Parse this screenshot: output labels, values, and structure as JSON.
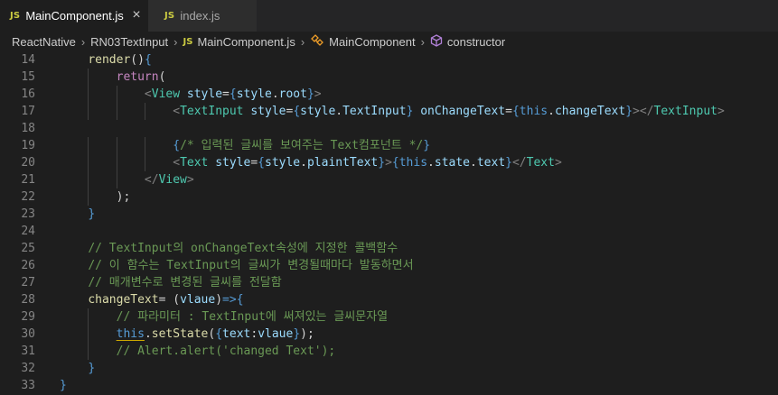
{
  "tabs": [
    {
      "badge": "JS",
      "label": "MainComponent.js",
      "close": "×",
      "active": true
    },
    {
      "badge": "JS",
      "label": "index.js",
      "active": false
    }
  ],
  "breadcrumb": {
    "items": [
      "ReactNative",
      "RN03TextInput",
      "MainComponent.js",
      "MainComponent",
      "constructor"
    ],
    "js_badge": "JS",
    "separator": "›"
  },
  "editor": {
    "lines": [
      {
        "no": "14",
        "text": "    render(){"
      },
      {
        "no": "15",
        "text": "        return("
      },
      {
        "no": "16",
        "text": "            <View style={style.root}>"
      },
      {
        "no": "17",
        "text": "                <TextInput style={style.TextInput} onChangeText={this.changeText}></TextInput>"
      },
      {
        "no": "18",
        "text": ""
      },
      {
        "no": "19",
        "text": "                {/* 입력된 글씨를 보여주는 Text컴포넌트 */}"
      },
      {
        "no": "20",
        "text": "                <Text style={style.plaintText}>{this.state.text}</Text>"
      },
      {
        "no": "21",
        "text": "            </View>"
      },
      {
        "no": "22",
        "text": "        );"
      },
      {
        "no": "23",
        "text": "    }"
      },
      {
        "no": "24",
        "text": ""
      },
      {
        "no": "25",
        "text": "    // TextInput의 onChangeText속성에 지정한 콜백함수"
      },
      {
        "no": "26",
        "text": "    // 이 함수는 TextInput의 글씨가 변경될때마다 발동하면서"
      },
      {
        "no": "27",
        "text": "    // 매개변수로 변경된 글씨를 전달함"
      },
      {
        "no": "28",
        "text": "    changeText= (vlaue)=>{"
      },
      {
        "no": "29",
        "text": "        // 파라미터 : TextInput에 써져있는 글씨문자열"
      },
      {
        "no": "30",
        "text": "        this.setState({text:vlaue});"
      },
      {
        "no": "31",
        "text": "        // Alert.alert('changed Text');"
      },
      {
        "no": "32",
        "text": "    }"
      },
      {
        "no": "33",
        "text": "}"
      }
    ]
  },
  "colors": {
    "background": "#1e1e1e",
    "tabbar": "#252526",
    "keyword": "#c586c0",
    "function": "#dcdcaa",
    "tag": "#4ec9b0",
    "attribute": "#9cdcfe",
    "brace": "#569cd6",
    "comment": "#6a9955",
    "line_number": "#858585",
    "js_badge": "#cbcb41"
  },
  "icons": {
    "breadcrumb_class": "class-symbol-icon",
    "breadcrumb_method": "method-cube-icon"
  }
}
